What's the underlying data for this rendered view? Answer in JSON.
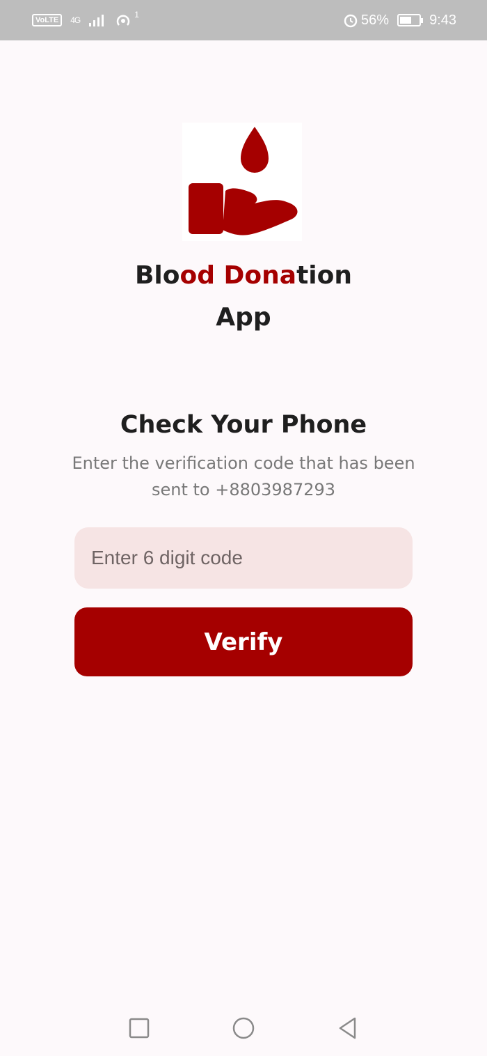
{
  "status_bar": {
    "volte": "VoLTE",
    "network": "4G",
    "hotspot_count": "1",
    "battery": "56%",
    "time": "9:43",
    "icons": [
      "volte-icon",
      "signal-icon",
      "hotspot-icon",
      "alarm-icon",
      "battery-icon"
    ]
  },
  "app": {
    "title_line1_parts": [
      "Blo",
      "od Dona",
      "tion"
    ],
    "title_line2": "App",
    "accent_color": "#a50000"
  },
  "verification": {
    "heading": "Check Your Phone",
    "description": "Enter the verification code that has been sent to +8803987293",
    "code_placeholder": "Enter 6 digit code",
    "code_value": "",
    "verify_label": "Verify"
  },
  "nav": {
    "icons": [
      "recent-apps-icon",
      "home-icon",
      "back-icon"
    ]
  }
}
